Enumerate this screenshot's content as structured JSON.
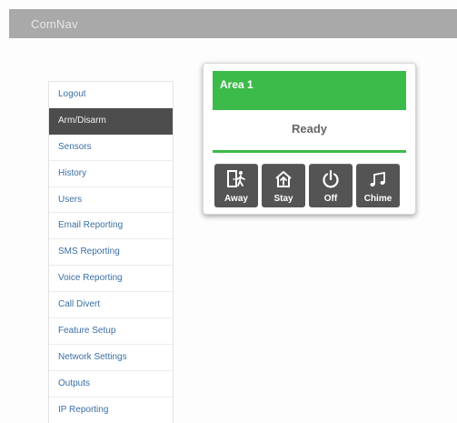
{
  "app": {
    "title": "ComNav"
  },
  "sidebar": {
    "items": [
      {
        "label": "Logout",
        "active": false
      },
      {
        "label": "Arm/Disarm",
        "active": true
      },
      {
        "label": "Sensors",
        "active": false
      },
      {
        "label": "History",
        "active": false
      },
      {
        "label": "Users",
        "active": false
      },
      {
        "label": "Email Reporting",
        "active": false
      },
      {
        "label": "SMS Reporting",
        "active": false
      },
      {
        "label": "Voice Reporting",
        "active": false
      },
      {
        "label": "Call Divert",
        "active": false
      },
      {
        "label": "Feature Setup",
        "active": false
      },
      {
        "label": "Network Settings",
        "active": false
      },
      {
        "label": "Outputs",
        "active": false
      },
      {
        "label": "IP Reporting",
        "active": false
      }
    ]
  },
  "area": {
    "title": "Area 1",
    "status": "Ready",
    "status_color": "#3dbb4a",
    "buttons": [
      {
        "label": "Away",
        "icon": "door-exit-icon"
      },
      {
        "label": "Stay",
        "icon": "house-arrow-icon"
      },
      {
        "label": "Off",
        "icon": "power-icon"
      },
      {
        "label": "Chime",
        "icon": "music-note-icon"
      }
    ]
  },
  "colors": {
    "accent_green": "#3dbb4a",
    "active_menu_bg": "#4d4d4d",
    "button_bg": "#545454",
    "link_blue": "#3a6fa4"
  }
}
